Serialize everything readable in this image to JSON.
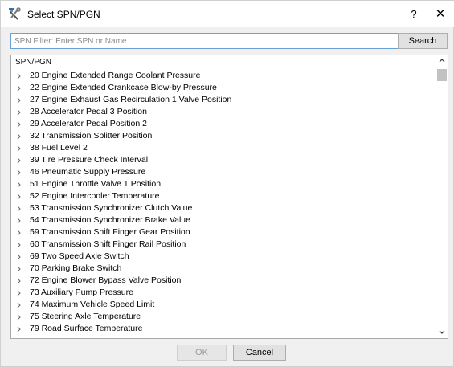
{
  "window": {
    "title": "Select SPN/PGN",
    "help_label": "?",
    "close_label": "✕"
  },
  "filter": {
    "placeholder": "SPN Filter: Enter SPN or Name",
    "value": ""
  },
  "search_label": "Search",
  "tree": {
    "header": "SPN/PGN",
    "items": [
      "20 Engine Extended Range Coolant Pressure",
      "22 Engine Extended Crankcase Blow-by Pressure",
      "27 Engine Exhaust Gas Recirculation 1 Valve Position",
      "28 Accelerator Pedal 3 Position",
      "29 Accelerator Pedal Position 2",
      "32 Transmission Splitter Position",
      "38 Fuel Level 2",
      "39 Tire Pressure Check Interval",
      "46 Pneumatic Supply Pressure",
      "51 Engine Throttle Valve 1 Position",
      "52 Engine Intercooler Temperature",
      "53 Transmission Synchronizer Clutch Value",
      "54 Transmission Synchronizer Brake Value",
      "59 Transmission Shift Finger Gear Position",
      "60 Transmission Shift Finger Rail Position",
      "69 Two Speed Axle Switch",
      "70 Parking Brake Switch",
      "72 Engine Blower Bypass Valve Position",
      "73 Auxiliary Pump Pressure",
      "74 Maximum Vehicle Speed Limit",
      "75 Steering Axle Temperature",
      "79 Road Surface Temperature"
    ]
  },
  "ok_label": "OK",
  "cancel_label": "Cancel"
}
